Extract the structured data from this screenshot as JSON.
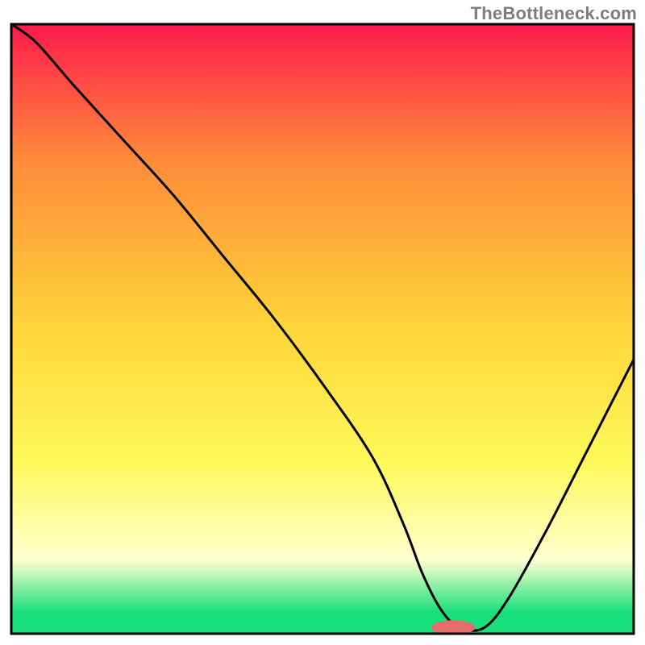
{
  "watermark": "TheBottleneck.com",
  "colors": {
    "top": "#ff1a4b",
    "mid_upper": "#ff8a3a",
    "mid": "#ffd53a",
    "mid_lower": "#fff95a",
    "pale": "#fdffd0",
    "green": "#18e07a",
    "marker_fill": "#e86c6c",
    "marker_stroke": "#b94d4d",
    "curve": "#000000",
    "frame": "#000000"
  },
  "chart_data": {
    "type": "line",
    "title": "",
    "xlabel": "",
    "ylabel": "",
    "xlim": [
      0,
      100
    ],
    "ylim": [
      0,
      100
    ],
    "x": [
      0,
      4,
      10,
      18,
      26,
      34,
      42,
      50,
      58,
      63,
      66,
      69,
      72,
      76,
      80,
      86,
      92,
      98,
      100
    ],
    "values": [
      100,
      97,
      90,
      81,
      72,
      62,
      52,
      41,
      29,
      18,
      10,
      4,
      1,
      1,
      6,
      17,
      29,
      41,
      45
    ],
    "marker": {
      "x": 71,
      "y": 1,
      "rx": 3.5,
      "ry": 1.2
    },
    "gradient_stops": [
      {
        "offset": 0,
        "key": "top"
      },
      {
        "offset": 0.22,
        "key": "mid_upper"
      },
      {
        "offset": 0.5,
        "key": "mid"
      },
      {
        "offset": 0.72,
        "key": "mid_lower"
      },
      {
        "offset": 0.88,
        "key": "pale"
      },
      {
        "offset": 0.965,
        "key": "green"
      },
      {
        "offset": 1.0,
        "key": "green"
      }
    ]
  }
}
